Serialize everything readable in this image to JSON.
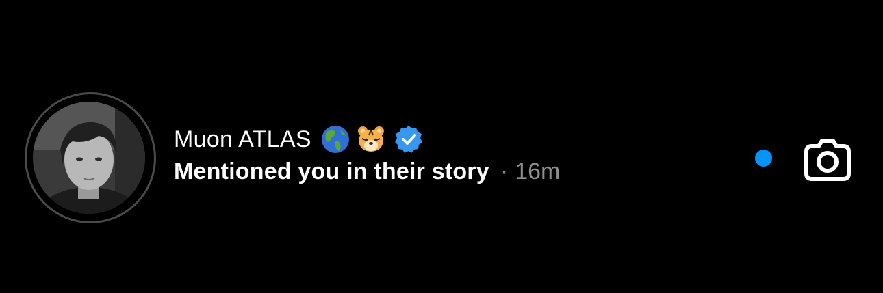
{
  "notification": {
    "username": "Muon ATLAS",
    "emoji_1": "globe-americas-emoji",
    "emoji_2": "tiger-face-emoji",
    "message": "Mentioned you in their story",
    "separator": "·",
    "time": "16m",
    "unread": true,
    "verified": true
  },
  "colors": {
    "background": "#000000",
    "text_primary": "#ffffff",
    "text_secondary": "#8e8e8e",
    "unread_dot": "#0095f6",
    "verified_badge": "#3897f0"
  },
  "icons": {
    "action": "camera-icon",
    "badge": "verified-badge-icon"
  }
}
